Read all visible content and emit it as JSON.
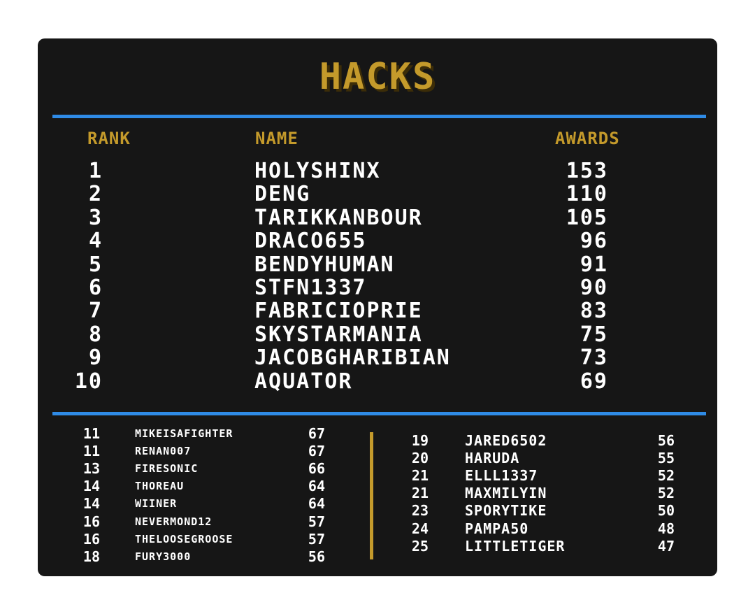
{
  "title": "HACKS",
  "colors": {
    "panel": "#161616",
    "accent_gold": "#c49a2b",
    "rule_blue": "#2f8be6",
    "text": "#ffffff"
  },
  "headers": {
    "rank": "RANK",
    "name": "NAME",
    "awards": "AWARDS"
  },
  "top10": [
    {
      "rank": "1",
      "name": "HOLYSHINX",
      "awards": "153"
    },
    {
      "rank": "2",
      "name": "DENG",
      "awards": "110"
    },
    {
      "rank": "3",
      "name": "TARIKKANBOUR",
      "awards": "105"
    },
    {
      "rank": "4",
      "name": "DRACO655",
      "awards": "96"
    },
    {
      "rank": "5",
      "name": "BENDYHUMAN",
      "awards": "91"
    },
    {
      "rank": "6",
      "name": "STFN1337",
      "awards": "90"
    },
    {
      "rank": "7",
      "name": "FABRICIOPRIE",
      "awards": "83"
    },
    {
      "rank": "8",
      "name": "SKYSTARMANIA",
      "awards": "75"
    },
    {
      "rank": "9",
      "name": "JACOBGHARIBIAN",
      "awards": "73"
    },
    {
      "rank": "10",
      "name": "AQUATOR",
      "awards": "69"
    }
  ],
  "rest_left": [
    {
      "rank": "11",
      "name": "MIKEISAFIGHTER",
      "awards": "67"
    },
    {
      "rank": "11",
      "name": "RENAN007",
      "awards": "67"
    },
    {
      "rank": "13",
      "name": "FIRESONIC",
      "awards": "66"
    },
    {
      "rank": "14",
      "name": "THOREAU",
      "awards": "64"
    },
    {
      "rank": "14",
      "name": "WIINER",
      "awards": "64"
    },
    {
      "rank": "16",
      "name": "NEVERMOND12",
      "awards": "57"
    },
    {
      "rank": "16",
      "name": "THELOOSEGROOSE",
      "awards": "57"
    },
    {
      "rank": "18",
      "name": "FURY3000",
      "awards": "56"
    }
  ],
  "rest_right": [
    {
      "rank": "19",
      "name": "JARED6502",
      "awards": "56"
    },
    {
      "rank": "20",
      "name": "HARUDA",
      "awards": "55"
    },
    {
      "rank": "21",
      "name": "ELLL1337",
      "awards": "52"
    },
    {
      "rank": "21",
      "name": "MAXMILYIN",
      "awards": "52"
    },
    {
      "rank": "23",
      "name": "SPORYTIKE",
      "awards": "50"
    },
    {
      "rank": "24",
      "name": "PAMPA50",
      "awards": "48"
    },
    {
      "rank": "25",
      "name": "LITTLETIGER",
      "awards": "47"
    }
  ]
}
